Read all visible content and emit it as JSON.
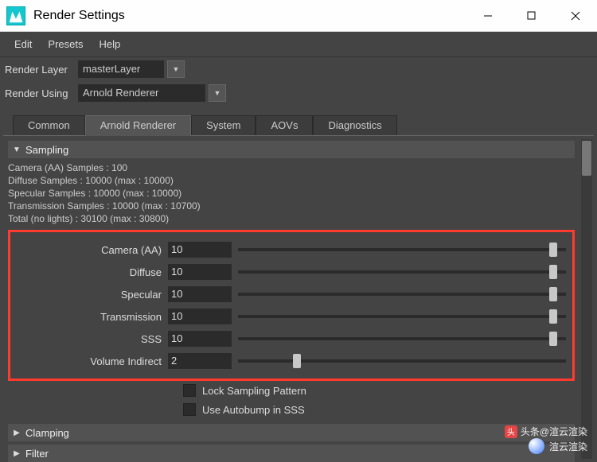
{
  "window": {
    "title": "Render Settings"
  },
  "menubar": {
    "edit": "Edit",
    "presets": "Presets",
    "help": "Help"
  },
  "opts": {
    "renderLayerLabel": "Render Layer",
    "renderLayerValue": "masterLayer",
    "renderUsingLabel": "Render Using",
    "renderUsingValue": "Arnold Renderer"
  },
  "tabs": {
    "common": "Common",
    "arnold": "Arnold Renderer",
    "system": "System",
    "aovs": "AOVs",
    "diagnostics": "Diagnostics"
  },
  "sections": {
    "sampling": "Sampling",
    "clamping": "Clamping",
    "filter": "Filter"
  },
  "sampleInfo": {
    "l1": "Camera (AA) Samples : 100",
    "l2": "Diffuse Samples : 10000 (max : 10000)",
    "l3": "Specular Samples : 10000 (max : 10000)",
    "l4": "Transmission Samples : 10000 (max : 10700)",
    "l5": "Total (no lights) : 30100 (max : 30800)"
  },
  "params": {
    "cameraAA": {
      "label": "Camera (AA)",
      "value": "10",
      "sliderPct": 96
    },
    "diffuse": {
      "label": "Diffuse",
      "value": "10",
      "sliderPct": 96
    },
    "specular": {
      "label": "Specular",
      "value": "10",
      "sliderPct": 96
    },
    "transmission": {
      "label": "Transmission",
      "value": "10",
      "sliderPct": 96
    },
    "sss": {
      "label": "SSS",
      "value": "10",
      "sliderPct": 96
    },
    "volumeIndirect": {
      "label": "Volume Indirect",
      "value": "2",
      "sliderPct": 18
    }
  },
  "checks": {
    "lockSampling": "Lock Sampling Pattern",
    "useAutobump": "Use Autobump in SSS"
  },
  "watermark": {
    "line1": "头条@渲云渲染",
    "line2": "渲云渲染"
  }
}
